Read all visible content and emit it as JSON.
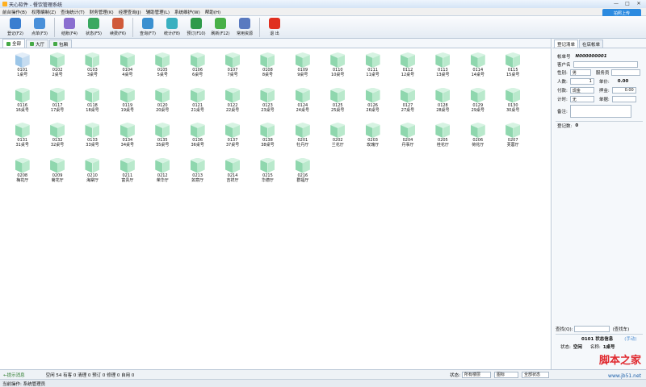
{
  "window": {
    "title": "天心软件 - 餐饮管理系统"
  },
  "menu": [
    "前台操作(B)",
    "权限编制(Z)",
    "查询统计(T)",
    "财务管理(K)",
    "经理查询(J)",
    "辅助管理(L)",
    "系统维护(W)",
    "帮助(H)"
  ],
  "toolbar": [
    {
      "label": "登记(F2)",
      "icon": "register-icon",
      "color": "#3a7ed0"
    },
    {
      "label": "点单(F3)",
      "icon": "order-icon",
      "color": "#4a90d9"
    },
    {
      "label": "结账(F4)",
      "icon": "checkout-icon",
      "color": "#8a6fd0"
    },
    {
      "label": "状态(F5)",
      "icon": "status-icon",
      "color": "#3aa860"
    },
    {
      "label": "续费(F6)",
      "icon": "renew-icon",
      "color": "#d05a3a"
    },
    {
      "label": "查询(F7)",
      "icon": "query-icon",
      "color": "#3a90d0"
    },
    {
      "label": "统计(F8)",
      "icon": "stats-icon",
      "color": "#3ab0c0"
    },
    {
      "label": "预订(F10)",
      "icon": "reserve-icon",
      "color": "#2f9a4a"
    },
    {
      "label": "刷新(F12)",
      "icon": "refresh-icon",
      "color": "#48b048"
    },
    {
      "label": "常用资源",
      "icon": "resources-icon",
      "color": "#5a7ac0"
    },
    {
      "label": "退 出",
      "icon": "exit-icon",
      "color": "#e03020"
    }
  ],
  "upload_button": "拍照上传",
  "tabs": [
    "全部",
    "大厅",
    "包厢"
  ],
  "tables": [
    {
      "code": "0101",
      "name": "1桌号"
    },
    {
      "code": "0102",
      "name": "2桌号"
    },
    {
      "code": "0103",
      "name": "3桌号"
    },
    {
      "code": "0104",
      "name": "4桌号"
    },
    {
      "code": "0105",
      "name": "5桌号"
    },
    {
      "code": "0106",
      "name": "6桌号"
    },
    {
      "code": "0107",
      "name": "7桌号"
    },
    {
      "code": "0108",
      "name": "8桌号"
    },
    {
      "code": "0109",
      "name": "9桌号"
    },
    {
      "code": "0110",
      "name": "10桌号"
    },
    {
      "code": "0111",
      "name": "11桌号"
    },
    {
      "code": "0112",
      "name": "12桌号"
    },
    {
      "code": "0113",
      "name": "13桌号"
    },
    {
      "code": "0114",
      "name": "14桌号"
    },
    {
      "code": "0115",
      "name": "15桌号"
    },
    {
      "code": "0116",
      "name": "16桌号"
    },
    {
      "code": "0117",
      "name": "17桌号"
    },
    {
      "code": "0118",
      "name": "18桌号"
    },
    {
      "code": "0119",
      "name": "19桌号"
    },
    {
      "code": "0120",
      "name": "20桌号"
    },
    {
      "code": "0121",
      "name": "21桌号"
    },
    {
      "code": "0122",
      "name": "22桌号"
    },
    {
      "code": "0123",
      "name": "23桌号"
    },
    {
      "code": "0124",
      "name": "24桌号"
    },
    {
      "code": "0125",
      "name": "25桌号"
    },
    {
      "code": "0126",
      "name": "26桌号"
    },
    {
      "code": "0127",
      "name": "27桌号"
    },
    {
      "code": "0128",
      "name": "28桌号"
    },
    {
      "code": "0129",
      "name": "29桌号"
    },
    {
      "code": "0130",
      "name": "30桌号"
    },
    {
      "code": "0131",
      "name": "31桌号"
    },
    {
      "code": "0132",
      "name": "32桌号"
    },
    {
      "code": "0133",
      "name": "33桌号"
    },
    {
      "code": "0134",
      "name": "34桌号"
    },
    {
      "code": "0135",
      "name": "35桌号"
    },
    {
      "code": "0136",
      "name": "36桌号"
    },
    {
      "code": "0137",
      "name": "37桌号"
    },
    {
      "code": "0138",
      "name": "38桌号"
    },
    {
      "code": "0201",
      "name": "牡丹厅"
    },
    {
      "code": "0202",
      "name": "兰花厅"
    },
    {
      "code": "0203",
      "name": "玫瑰厅"
    },
    {
      "code": "0204",
      "name": "丹事厅"
    },
    {
      "code": "0205",
      "name": "桂花厅"
    },
    {
      "code": "0206",
      "name": "荷花厅"
    },
    {
      "code": "0207",
      "name": "芙蓉厅"
    },
    {
      "code": "0208",
      "name": "梅花厅"
    },
    {
      "code": "0209",
      "name": "菊花厅"
    },
    {
      "code": "0210",
      "name": "海棠厅"
    },
    {
      "code": "0211",
      "name": "富贵厅"
    },
    {
      "code": "0212",
      "name": "荣华厅"
    },
    {
      "code": "0213",
      "name": "如意厅"
    },
    {
      "code": "0214",
      "name": "吉祥厅"
    },
    {
      "code": "0215",
      "name": "华德厅"
    },
    {
      "code": "0216",
      "name": "群福厅"
    }
  ],
  "side": {
    "tabs": [
      "登记清单",
      "在店帐单"
    ],
    "account_label": "帐单号",
    "account_value": "N000000001",
    "customer_label": "客户名",
    "gender_label": "性别:",
    "gender_value": "男",
    "waiter_label": "服务员",
    "people_label": "人数:",
    "people_value": "1",
    "price_label": "单价:",
    "price_value": "0.00",
    "pay_label": "付款:",
    "pay_value": "现金",
    "deposit_label": "押金:",
    "deposit_value": "0.00",
    "timing_label": "计时:",
    "timing_value": "无",
    "note_label": "单据:",
    "remark_label": "备注:",
    "count_label": "登记数:",
    "count_value": "0",
    "search_label": "查找(Q):",
    "search_btn": "(查找车)",
    "info_title": "0101 状态信息",
    "info_tag": "(手动)",
    "state_label": "状态:",
    "state_value": "空闲",
    "name_label": "名称:",
    "name_value": "1桌号"
  },
  "statusbar": {
    "tip": "←提示消息",
    "counts": "空闲 54  有客 0  清理 0  预订 0  修理 0  自用 0",
    "state_label": "状态:",
    "state_value": "所有楼层",
    "view_value": "图标",
    "all_value": "全部状态"
  },
  "bottom": {
    "text": "当前操作: 系统管理员"
  },
  "watermark": {
    "text": "脚本之家",
    "url": "www.jb51.net"
  }
}
